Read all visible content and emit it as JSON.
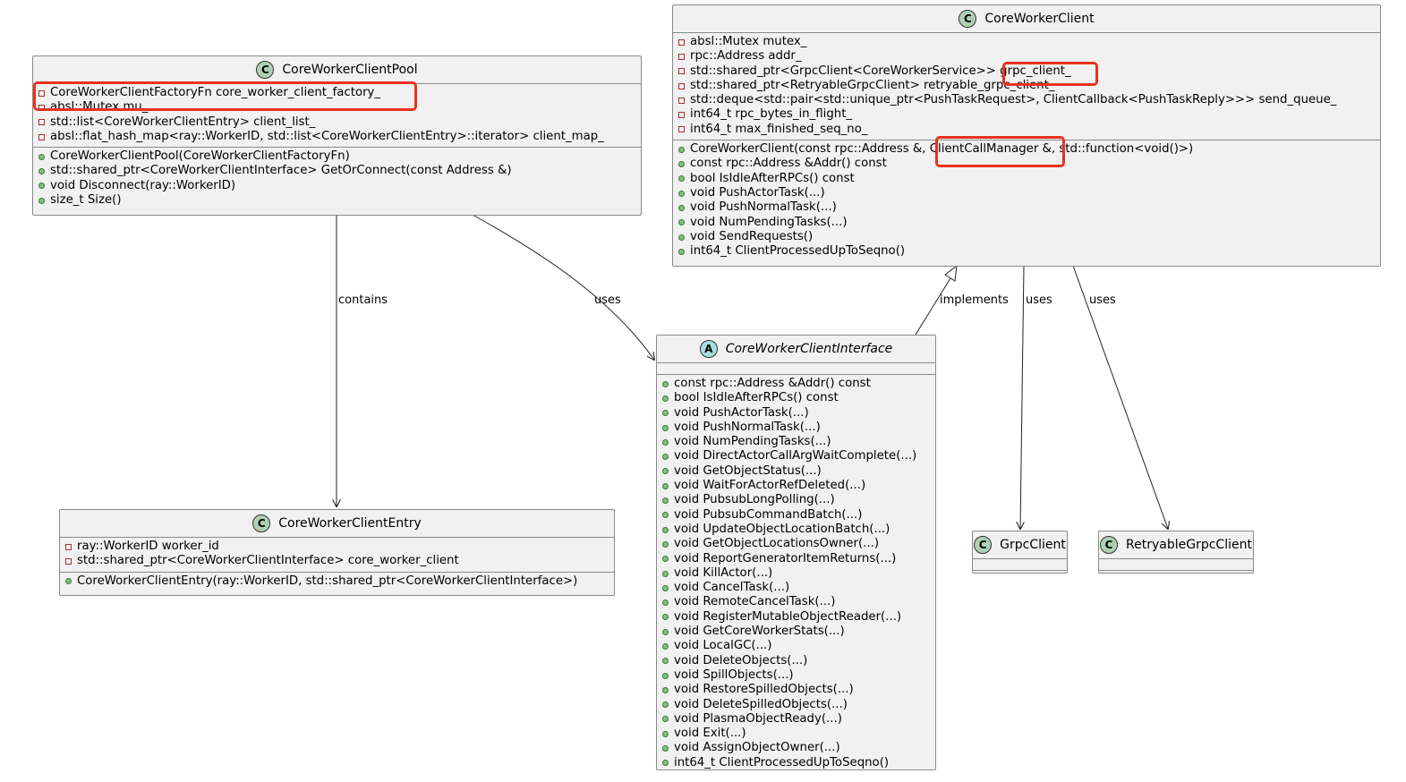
{
  "classes": {
    "pool": {
      "name": "CoreWorkerClientPool",
      "attributes": [
        {
          "vis": "private",
          "text": "CoreWorkerClientFactoryFn core_worker_client_factory_"
        },
        {
          "vis": "private",
          "text": "absl::Mutex mu_"
        },
        {
          "vis": "private",
          "text": "std::list<CoreWorkerClientEntry> client_list_"
        },
        {
          "vis": "private",
          "text": "absl::flat_hash_map<ray::WorkerID, std::list<CoreWorkerClientEntry>::iterator> client_map_"
        }
      ],
      "methods": [
        {
          "vis": "public",
          "text": "CoreWorkerClientPool(CoreWorkerClientFactoryFn)"
        },
        {
          "vis": "public",
          "text": "std::shared_ptr<CoreWorkerClientInterface> GetOrConnect(const Address &)"
        },
        {
          "vis": "public",
          "text": "void Disconnect(ray::WorkerID)"
        },
        {
          "vis": "public",
          "text": "size_t Size()"
        }
      ]
    },
    "client": {
      "name": "CoreWorkerClient",
      "attributes": [
        {
          "vis": "private",
          "text": "absl::Mutex mutex_"
        },
        {
          "vis": "private",
          "text": "rpc::Address addr_"
        },
        {
          "vis": "private",
          "text": "std::shared_ptr<GrpcClient<CoreWorkerService>> grpc_client_"
        },
        {
          "vis": "private",
          "text": "std::shared_ptr<RetryableGrpcClient> retryable_grpc_client_"
        },
        {
          "vis": "private",
          "text": "std::deque<std::pair<std::unique_ptr<PushTaskRequest>, ClientCallback<PushTaskReply>>> send_queue_"
        },
        {
          "vis": "private",
          "text": "int64_t rpc_bytes_in_flight_"
        },
        {
          "vis": "private",
          "text": "int64_t max_finished_seq_no_"
        }
      ],
      "methods": [
        {
          "vis": "public",
          "text": "CoreWorkerClient(const rpc::Address &, ClientCallManager &, std::function<void()>)"
        },
        {
          "vis": "public",
          "text": "const rpc::Address &Addr() const"
        },
        {
          "vis": "public",
          "text": "bool IsIdleAfterRPCs() const"
        },
        {
          "vis": "public",
          "text": "void PushActorTask(...)"
        },
        {
          "vis": "public",
          "text": "void PushNormalTask(...)"
        },
        {
          "vis": "public",
          "text": "void NumPendingTasks(...)"
        },
        {
          "vis": "public",
          "text": "void SendRequests()"
        },
        {
          "vis": "public",
          "text": "int64_t ClientProcessedUpToSeqno()"
        }
      ]
    },
    "entry": {
      "name": "CoreWorkerClientEntry",
      "attributes": [
        {
          "vis": "private",
          "text": "ray::WorkerID worker_id"
        },
        {
          "vis": "private",
          "text": "std::shared_ptr<CoreWorkerClientInterface> core_worker_client"
        }
      ],
      "methods": [
        {
          "vis": "public",
          "text": "CoreWorkerClientEntry(ray::WorkerID, std::shared_ptr<CoreWorkerClientInterface>)"
        }
      ]
    },
    "iface": {
      "name": "CoreWorkerClientInterface",
      "methods": [
        {
          "vis": "public",
          "text": "const rpc::Address &Addr() const"
        },
        {
          "vis": "public",
          "text": "bool IsIdleAfterRPCs() const"
        },
        {
          "vis": "public",
          "text": "void PushActorTask(...)"
        },
        {
          "vis": "public",
          "text": "void PushNormalTask(...)"
        },
        {
          "vis": "public",
          "text": "void NumPendingTasks(...)"
        },
        {
          "vis": "public",
          "text": "void DirectActorCallArgWaitComplete(...)"
        },
        {
          "vis": "public",
          "text": "void GetObjectStatus(...)"
        },
        {
          "vis": "public",
          "text": "void WaitForActorRefDeleted(...)"
        },
        {
          "vis": "public",
          "text": "void PubsubLongPolling(...)"
        },
        {
          "vis": "public",
          "text": "void PubsubCommandBatch(...)"
        },
        {
          "vis": "public",
          "text": "void UpdateObjectLocationBatch(...)"
        },
        {
          "vis": "public",
          "text": "void GetObjectLocationsOwner(...)"
        },
        {
          "vis": "public",
          "text": "void ReportGeneratorItemReturns(...)"
        },
        {
          "vis": "public",
          "text": "void KillActor(...)"
        },
        {
          "vis": "public",
          "text": "void CancelTask(...)"
        },
        {
          "vis": "public",
          "text": "void RemoteCancelTask(...)"
        },
        {
          "vis": "public",
          "text": "void RegisterMutableObjectReader(...)"
        },
        {
          "vis": "public",
          "text": "void GetCoreWorkerStats(...)"
        },
        {
          "vis": "public",
          "text": "void LocalGC(...)"
        },
        {
          "vis": "public",
          "text": "void DeleteObjects(...)"
        },
        {
          "vis": "public",
          "text": "void SpillObjects(...)"
        },
        {
          "vis": "public",
          "text": "void RestoreSpilledObjects(...)"
        },
        {
          "vis": "public",
          "text": "void DeleteSpilledObjects(...)"
        },
        {
          "vis": "public",
          "text": "void PlasmaObjectReady(...)"
        },
        {
          "vis": "public",
          "text": "void Exit(...)"
        },
        {
          "vis": "public",
          "text": "void AssignObjectOwner(...)"
        },
        {
          "vis": "public",
          "text": "int64_t ClientProcessedUpToSeqno()"
        }
      ]
    },
    "grpc": {
      "name": "GrpcClient"
    },
    "retry": {
      "name": "RetryableGrpcClient"
    }
  },
  "edges": {
    "contains": "contains",
    "pool_uses": "uses",
    "implements": "implements",
    "grpc_uses": "uses",
    "retry_uses": "uses"
  },
  "icons": {
    "class": "C",
    "abstract": "A"
  },
  "colors": {
    "highlight": "#e8321e",
    "class_fill": "#f1f1f1",
    "class_icon": "#add1b2",
    "abstract_icon": "#a9dcdf"
  }
}
